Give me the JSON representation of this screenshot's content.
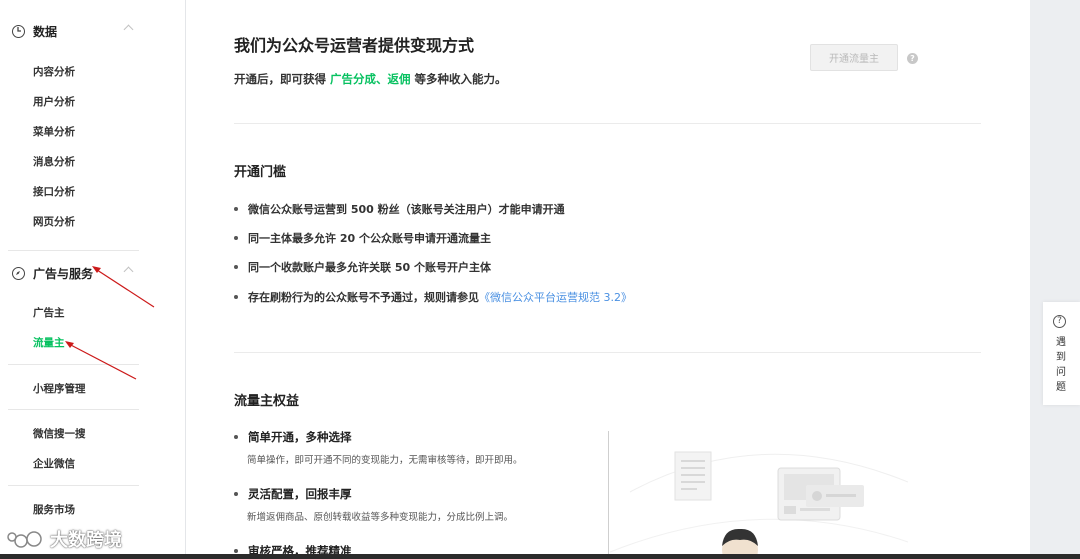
{
  "sidebar": {
    "data_label": "数据",
    "data_items": [
      "内容分析",
      "用户分析",
      "菜单分析",
      "消息分析",
      "接口分析",
      "网页分析"
    ],
    "ads_label": "广告与服务",
    "ads_items": [
      "广告主",
      "流量主"
    ],
    "mini_program": "小程序管理",
    "search": "微信搜一搜",
    "wecom": "企业微信",
    "market": "服务市场"
  },
  "main": {
    "title": "我们为公众号运营者提供变现方式",
    "subtitle_before": "开通后，即可获得 ",
    "subtitle_highlight": "广告分成、返佣",
    "subtitle_after": " 等多种收入能力。",
    "open_button": "开通流量主",
    "help_glyph": "?",
    "threshold_title": "开通门槛",
    "threshold_items": [
      "微信公众账号运营到 500 粉丝（该账号关注用户）才能申请开通",
      "同一主体最多允许 20 个公众账号申请开通流量主",
      "同一个收款账户最多允许关联 50 个账号开户主体"
    ],
    "threshold_last_before": "存在刷粉行为的公众账号不予通过，规则请参见",
    "threshold_last_link": "《微信公众平台运营规范 3.2》",
    "benefits_title": "流量主权益",
    "benefits": [
      {
        "title": "简单开通，多种选择",
        "desc": "简单操作，即可开通不同的变现能力，无需审核等待，即开即用。"
      },
      {
        "title": "灵活配置，回报丰厚",
        "desc": "新增返佣商品、原创转载收益等多种变现能力，分成比例上调。"
      },
      {
        "title": "审核严格，推荐精准",
        "desc": ""
      }
    ]
  },
  "helptab": {
    "icon": "?",
    "text": "遇到问题"
  },
  "watermark": {
    "text": "大数跨境"
  },
  "colors": {
    "accent": "#07c160",
    "link": "#576b95",
    "arrow": "#cc1a1a"
  }
}
